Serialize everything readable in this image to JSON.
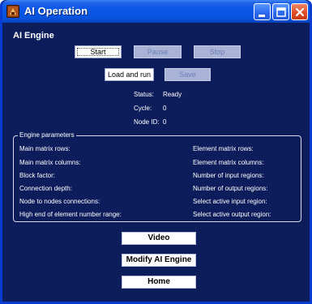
{
  "window": {
    "title": "AI Operation",
    "icons": {
      "app": "app-icon",
      "minimize": "minimize-icon",
      "maximize": "maximize-icon",
      "close": "close-icon"
    }
  },
  "heading": "AI Engine",
  "controls": {
    "start": "Start",
    "pause": "Pause",
    "stop": "Stop",
    "load_and_run": "Load and run",
    "save": "Save"
  },
  "status": {
    "status_label": "Status:",
    "status_value": "Ready",
    "cycle_label": "Cycle:",
    "cycle_value": "0",
    "node_label": "Node ID:",
    "node_value": "0"
  },
  "engine_parameters": {
    "legend": "Engine parameters",
    "left": [
      "Main matrix rows:",
      "Main matrix columns:",
      "Block factor:",
      "Connection depth:",
      "Node to nodes connections:",
      "High end of element number range:"
    ],
    "right": [
      "Element matrix rows:",
      "Element matrix columns:",
      "Number of input regions:",
      "Number of output regions:",
      "Select active input region:",
      "Select active output region:"
    ]
  },
  "navigation": {
    "video": "Video",
    "modify": "Modify AI Engine",
    "home": "Home"
  },
  "colors": {
    "window_bg": "#0d1d5c",
    "titlebar": "#0a57e8",
    "disabled_button": "#a8b3d6"
  }
}
